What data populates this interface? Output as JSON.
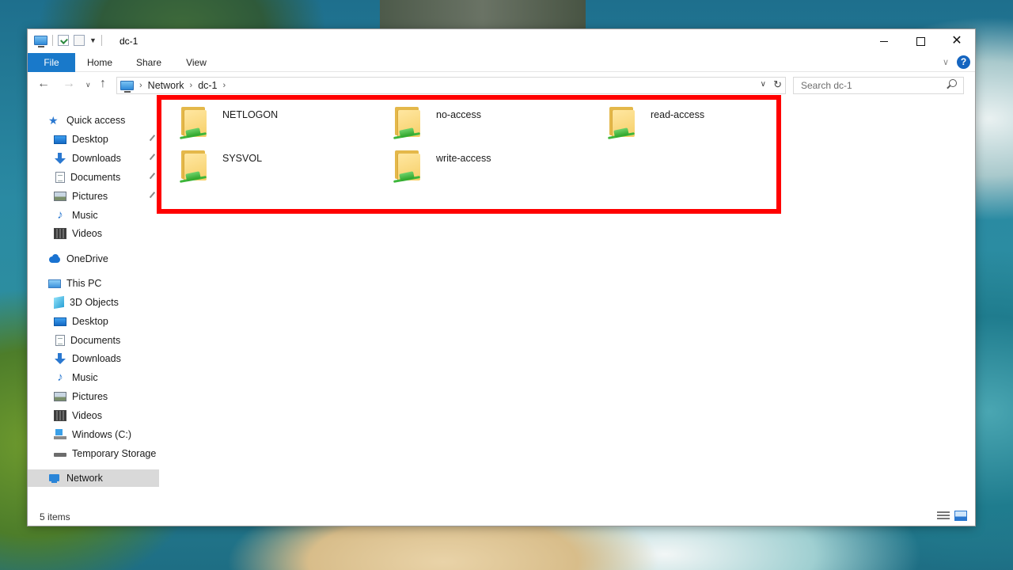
{
  "window": {
    "title": "dc-1"
  },
  "ribbon": {
    "tabs": [
      "File",
      "Home",
      "Share",
      "View"
    ]
  },
  "address": {
    "crumbs": [
      "Network",
      "dc-1"
    ]
  },
  "search": {
    "placeholder": "Search dc-1"
  },
  "sidebar": {
    "items": [
      {
        "label": "Quick access",
        "icon": "star-icon",
        "level": 0
      },
      {
        "label": "Desktop",
        "icon": "desktop-icon",
        "level": 1,
        "pinned": true
      },
      {
        "label": "Downloads",
        "icon": "downloads-icon",
        "level": 1,
        "pinned": true
      },
      {
        "label": "Documents",
        "icon": "documents-icon",
        "level": 1,
        "pinned": true
      },
      {
        "label": "Pictures",
        "icon": "pictures-icon",
        "level": 1,
        "pinned": true
      },
      {
        "label": "Music",
        "icon": "music-icon",
        "level": 1
      },
      {
        "label": "Videos",
        "icon": "videos-icon",
        "level": 1
      },
      {
        "label": "OneDrive",
        "icon": "onedrive-icon",
        "level": 0
      },
      {
        "label": "This PC",
        "icon": "this-pc-icon",
        "level": 0
      },
      {
        "label": "3D Objects",
        "icon": "3d-objects-icon",
        "level": 1
      },
      {
        "label": "Desktop",
        "icon": "desktop-icon",
        "level": 1
      },
      {
        "label": "Documents",
        "icon": "documents-icon",
        "level": 1
      },
      {
        "label": "Downloads",
        "icon": "downloads-icon",
        "level": 1
      },
      {
        "label": "Music",
        "icon": "music-icon",
        "level": 1
      },
      {
        "label": "Pictures",
        "icon": "pictures-icon",
        "level": 1
      },
      {
        "label": "Videos",
        "icon": "videos-icon",
        "level": 1
      },
      {
        "label": "Windows (C:)",
        "icon": "windows-drive-icon",
        "level": 1
      },
      {
        "label": "Temporary Storage",
        "icon": "drive-icon",
        "level": 1
      },
      {
        "label": "Network",
        "icon": "network-icon",
        "level": 0,
        "selected": true
      }
    ]
  },
  "content": {
    "items": [
      {
        "name": "NETLOGON",
        "icon": "shared-folder-icon"
      },
      {
        "name": "no-access",
        "icon": "shared-folder-icon"
      },
      {
        "name": "read-access",
        "icon": "shared-folder-icon"
      },
      {
        "name": "SYSVOL",
        "icon": "shared-folder-icon"
      },
      {
        "name": "write-access",
        "icon": "shared-folder-icon"
      }
    ]
  },
  "status": {
    "count": "5 items"
  },
  "colors": {
    "accent": "#1979ca",
    "highlight": "#ff0000",
    "selected": "#d9d9d9"
  }
}
